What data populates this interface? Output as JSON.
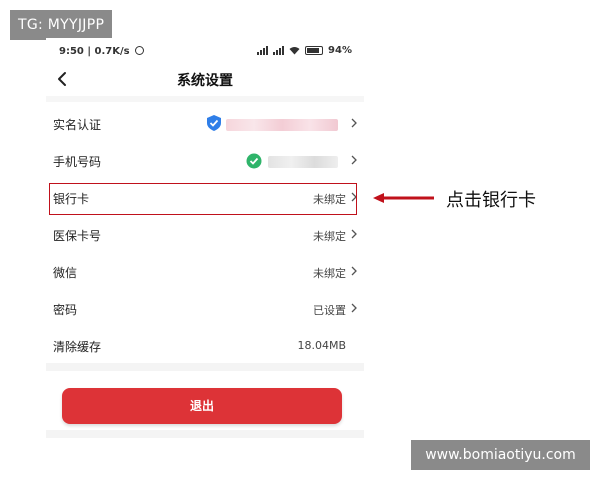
{
  "watermark_top_left": "TG: MYYJJPP",
  "watermark_bottom_right": "www.bomiaotiyu.com",
  "status_bar": {
    "time_speed": "9:50 | 0.7K/s",
    "battery": "94",
    "icons": [
      "alarm-icon",
      "signal-icon",
      "signal-icon",
      "wifi-icon",
      "battery-icon"
    ]
  },
  "nav": {
    "title": "系统设置",
    "back_icon": "chevron-left-icon"
  },
  "settings": {
    "real_name": {
      "label": "实名认证",
      "icon": "shield-check-icon"
    },
    "phone": {
      "label": "手机号码",
      "icon": "check-circle-icon"
    },
    "bank_card": {
      "label": "银行卡",
      "value": "未绑定"
    },
    "medical_card": {
      "label": "医保卡号",
      "value": "未绑定"
    },
    "wechat": {
      "label": "微信",
      "value": "未绑定"
    },
    "password": {
      "label": "密码",
      "value": "已设置"
    },
    "clear_cache": {
      "label": "清除缓存",
      "value": "18.04MB"
    }
  },
  "logout_button": "退出",
  "annotation": "点击银行卡",
  "colors": {
    "accent_red": "#dd3337",
    "highlight_red": "#c0111b",
    "shield_blue": "#2f7ee8",
    "check_green": "#2fb46a"
  }
}
